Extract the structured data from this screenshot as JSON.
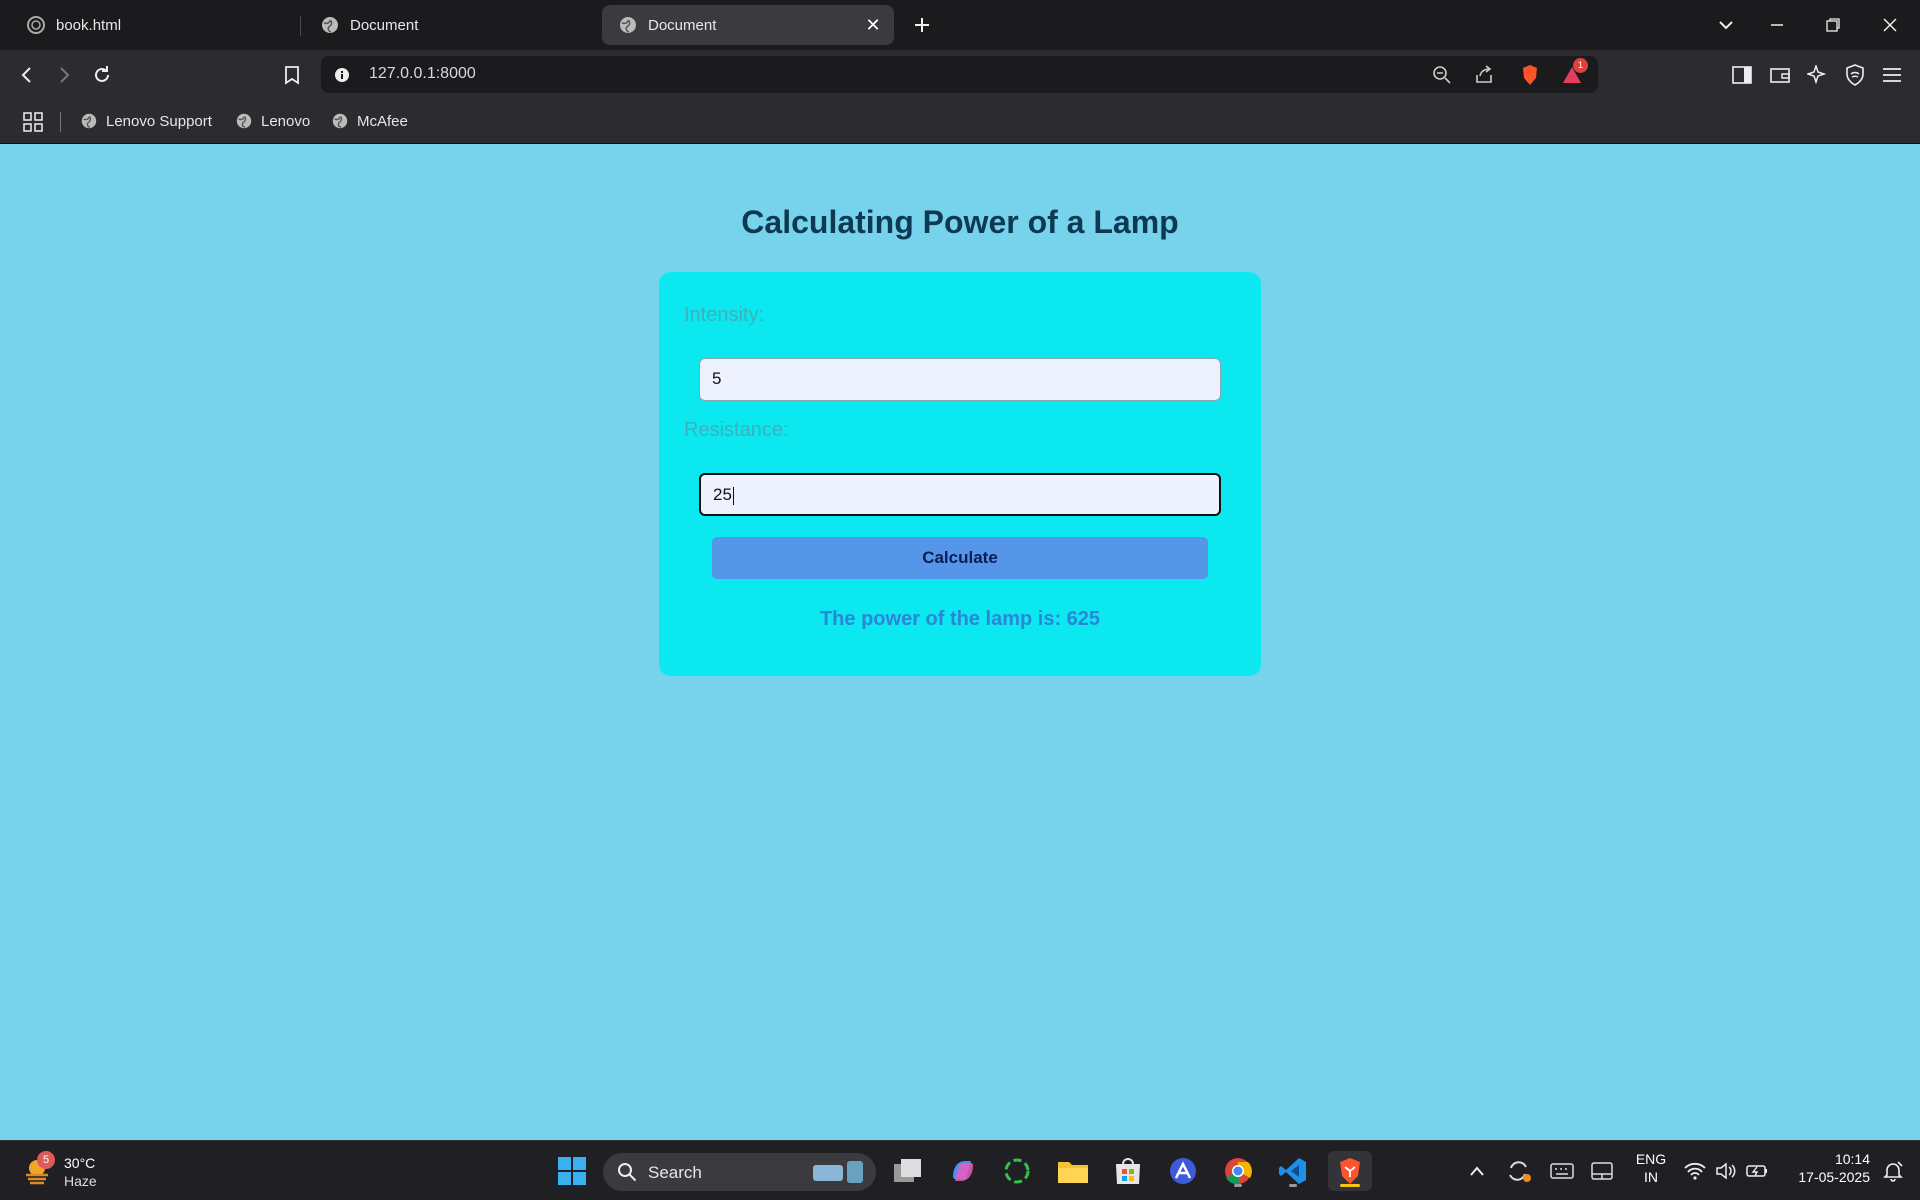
{
  "browser": {
    "tabs": [
      {
        "title": "book.html"
      },
      {
        "title": "Document"
      },
      {
        "title": "Document",
        "active": true
      }
    ],
    "url": "127.0.0.1:8000",
    "bookmarks": [
      "Lenovo Support",
      "Lenovo",
      "McAfee"
    ],
    "rewards_badge": "1"
  },
  "page": {
    "title": "Calculating Power of a Lamp",
    "intensity_label": "Intensity:",
    "intensity_value": "5",
    "resistance_label": "Resistance:",
    "resistance_value": "25",
    "calculate_label": "Calculate",
    "result_text": "The power of the lamp is: 625"
  },
  "taskbar": {
    "weather_badge": "5",
    "weather_temp": "30°C",
    "weather_condition": "Haze",
    "search_label": "Search",
    "language": "ENG",
    "region": "IN",
    "time": "10:14",
    "date": "17-05-2025"
  },
  "colors": {
    "page_bg": "#77d3eb",
    "card_bg": "#0ce8f0",
    "button_bg": "#5696e8",
    "title_color": "#0d3a52",
    "result_color": "#2a86d6"
  }
}
